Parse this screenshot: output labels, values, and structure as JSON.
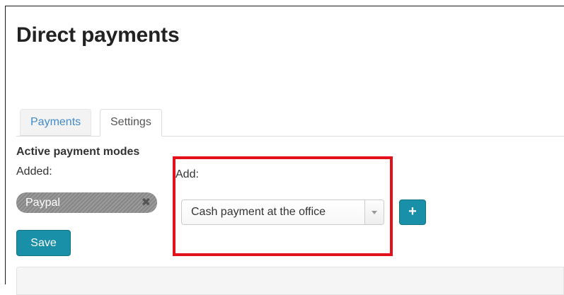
{
  "page": {
    "title": "Direct payments"
  },
  "tabs": [
    {
      "label": "Payments",
      "active": false
    },
    {
      "label": "Settings",
      "active": true
    }
  ],
  "payment_modes": {
    "heading": "Active payment modes",
    "added_label": "Added:",
    "added_items": [
      {
        "label": "Paypal",
        "remove_icon": "close-icon"
      }
    ],
    "save_label": "Save"
  },
  "add_panel": {
    "label": "Add:",
    "selected_value": "Cash payment at the office",
    "add_button_icon": "plus-icon",
    "add_button_glyph": "+"
  },
  "colors": {
    "accent": "#1a8fa8",
    "tab_link": "#428bca",
    "highlight": "#e3111b",
    "chip": "#8e8e8e"
  }
}
